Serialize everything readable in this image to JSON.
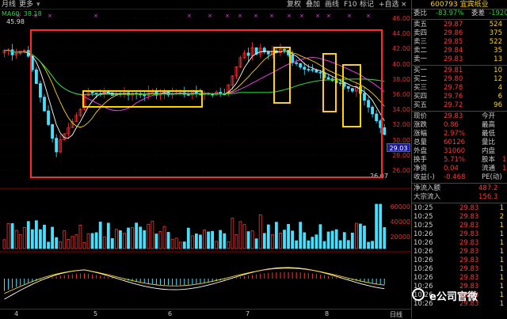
{
  "toolbar": {
    "tabs": [
      "月线",
      "更多"
    ],
    "buttons": [
      "复权",
      "叠加",
      "画线",
      "F10",
      "标记",
      "+自选"
    ],
    "close": "×"
  },
  "stock": {
    "code": "600793",
    "name": "宜宾纸业"
  },
  "ma_label": "MA60: 38.18",
  "high_marker": "45.98",
  "low_marker": "26.07",
  "current_price_tag": "29.03",
  "price_axis": [
    "46.00",
    "44.00",
    "42.00",
    "40.00",
    "38.00",
    "36.00",
    "34.00",
    "32.00",
    "30.00",
    "28.00",
    "26.00"
  ],
  "volume_axis": [
    "60000",
    "40000",
    "20000"
  ],
  "date_axis": [
    "4",
    "5",
    "6",
    "7",
    "8",
    "日线"
  ],
  "order_ratio": {
    "label1": "委比",
    "val1": "-83.97%",
    "label2": "委差",
    "val2": "-1920"
  },
  "asks": [
    {
      "label": "卖五",
      "price": "29.87",
      "vol": "524"
    },
    {
      "label": "卖四",
      "price": "29.86",
      "vol": "375"
    },
    {
      "label": "卖三",
      "price": "29.85",
      "vol": "522"
    },
    {
      "label": "卖二",
      "price": "29.84",
      "vol": "35"
    },
    {
      "label": "卖一",
      "price": "29.83",
      "vol": "13"
    }
  ],
  "bids": [
    {
      "label": "买一",
      "price": "29.81",
      "vol": "10"
    },
    {
      "label": "买二",
      "price": "29.80",
      "vol": "12"
    },
    {
      "label": "买三",
      "price": "29.78",
      "vol": "4"
    },
    {
      "label": "买四",
      "price": "29.76",
      "vol": "6"
    },
    {
      "label": "买五",
      "price": "29.72",
      "vol": "96"
    }
  ],
  "quote": [
    {
      "l1": "现价",
      "v1": "29.83",
      "l2": "今开",
      "v2": ""
    },
    {
      "l1": "涨跌",
      "v1": "0.86",
      "l2": "最高",
      "v2": ""
    },
    {
      "l1": "涨幅",
      "v1": "2.97%",
      "l2": "最低",
      "v2": ""
    },
    {
      "l1": "总量",
      "v1": "60126",
      "l2": "量比",
      "v2": ""
    },
    {
      "l1": "外盘",
      "v1": "31060",
      "l2": "内盘",
      "v2": ""
    },
    {
      "l1": "换手",
      "v1": "5.71%",
      "l2": "股本",
      "v2": "1"
    },
    {
      "l1": "净资",
      "v1": "0.04",
      "l2": "流通",
      "v2": "1"
    },
    {
      "l1": "收益(-)",
      "v1": "-0.468",
      "l2": "PE(动)",
      "v2": ""
    }
  ],
  "flows": [
    {
      "label": "净流入额",
      "value": "487.2"
    },
    {
      "label": "大宗流入",
      "value": "156.3"
    }
  ],
  "ticks": [
    {
      "time": "10:25",
      "price": "29.83",
      "vol": "1"
    },
    {
      "time": "10:25",
      "price": "29.83",
      "vol": "2"
    },
    {
      "time": "10:25",
      "price": "29.83",
      "vol": "1"
    },
    {
      "time": "10:26",
      "price": "29.83",
      "vol": "1"
    },
    {
      "time": "10:26",
      "price": "29.83",
      "vol": "1"
    },
    {
      "time": "10:26",
      "price": "29.83",
      "vol": "1"
    },
    {
      "time": "10:26",
      "price": "29.83",
      "vol": "1"
    },
    {
      "time": "10:26",
      "price": "29.83",
      "vol": "1"
    },
    {
      "time": "10:26",
      "price": "29.83",
      "vol": "1"
    },
    {
      "time": "10:26",
      "price": "29.83",
      "vol": "1"
    },
    {
      "time": "10:26",
      "price": "29.83",
      "vol": "1"
    },
    {
      "time": "10:26",
      "price": "29.83",
      "vol": "1"
    }
  ],
  "watermark": "e公司官微",
  "colors": {
    "up": "#ff3333",
    "down": "#44e0ff",
    "ma5": "#ffffff",
    "ma10": "#ffd400",
    "ma20": "#ff44ff",
    "ma60": "#2ecc40",
    "highlight_red": "#ff2a2a",
    "highlight_yellow": "#ffd400"
  }
}
